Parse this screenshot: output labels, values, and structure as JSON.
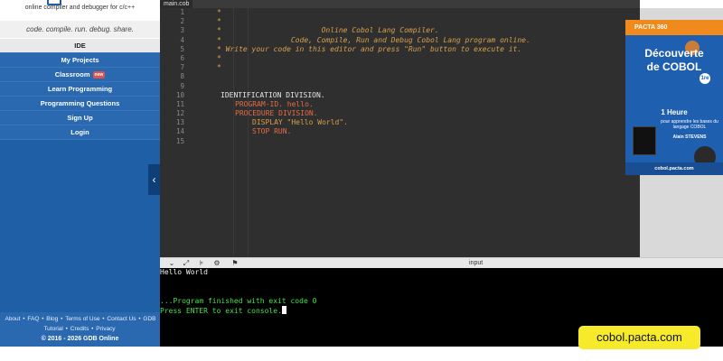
{
  "sidebar": {
    "tagline": "online compiler and debugger for c/c++",
    "motto": "code. compile. run. debug. share.",
    "nav": [
      {
        "label": "IDE",
        "badge": ""
      },
      {
        "label": "My Projects",
        "badge": ""
      },
      {
        "label": "Classroom",
        "badge": "new"
      },
      {
        "label": "Learn Programming",
        "badge": ""
      },
      {
        "label": "Programming Questions",
        "badge": ""
      },
      {
        "label": "Sign Up",
        "badge": ""
      },
      {
        "label": "Login",
        "badge": ""
      }
    ],
    "collapse_icon": "‹",
    "footer": {
      "links": [
        "About",
        "FAQ",
        "Blog",
        "Terms of Use",
        "Contact Us",
        "GDB Tutorial",
        "Credits",
        "Privacy"
      ],
      "copyright": "© 2016 - 2026 GDB Online"
    }
  },
  "editor": {
    "tab": "main.cob",
    "line_numbers": [
      "1",
      "2",
      "3",
      "4",
      "5",
      "6",
      "7",
      "8",
      "9",
      "10",
      "11",
      "12",
      "13",
      "14",
      "15"
    ],
    "lines": [
      "*",
      "*",
      "*                       Online Cobol Lang Compiler.",
      "*                Code, Compile, Run and Debug Cobol Lang program online.",
      "* Write your code in this editor and press \"Run\" button to execute it.",
      "*",
      "*",
      "",
      "",
      "IDENTIFICATION DIVISION.",
      "PROGRAM-ID. hello.",
      "PROCEDURE DIVISION.",
      "DISPLAY \"Hello World\".",
      "STOP RUN.",
      ""
    ]
  },
  "ad": {
    "brand": "PACTA 360",
    "title_1": "Découverte",
    "title_2": "de COBOL",
    "edition": "1re",
    "hours": "1 Heure",
    "subtitle": "pour apprendre les bases du langage COBOL",
    "author": "Alain STEVENS",
    "url": "cobol.pacta.com"
  },
  "console": {
    "toolbar_icons": [
      "chevron-down-icon",
      "expand-icon",
      "format-icon",
      "gear-icon",
      "debug-icon"
    ],
    "input_label": "input",
    "output": [
      "Hello World",
      "",
      "",
      "...Program finished with exit code 0",
      "Press ENTER to exit console."
    ]
  },
  "watermark": "cobol.pacta.com"
}
